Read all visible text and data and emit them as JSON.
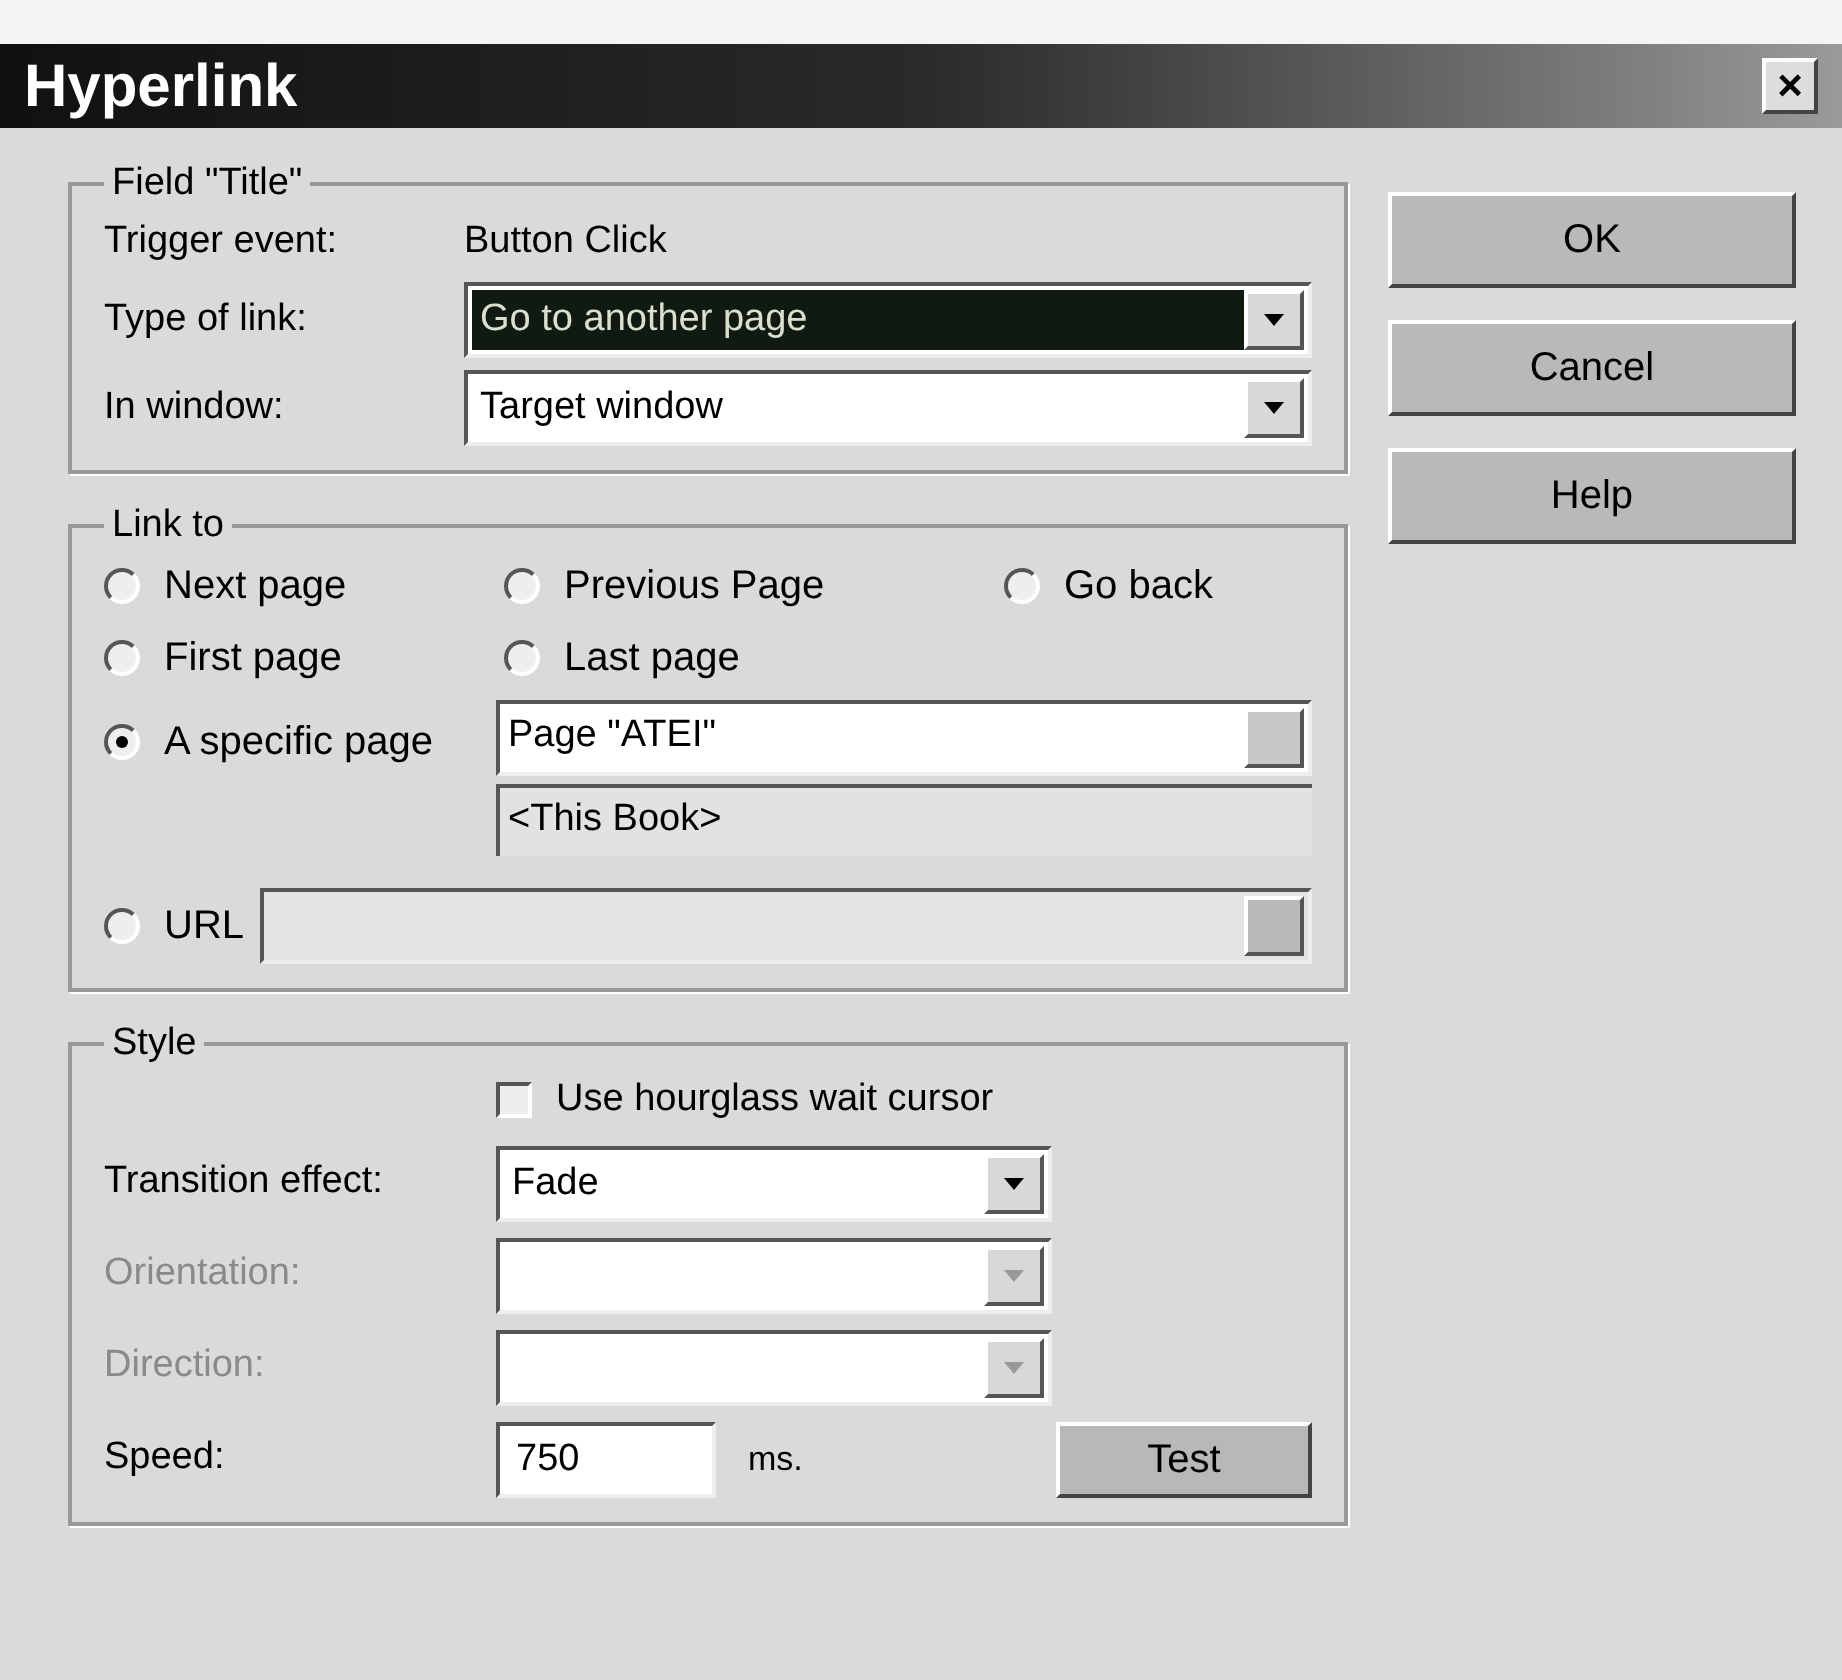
{
  "window": {
    "title": "Hyperlink",
    "close": "×"
  },
  "field_group": {
    "legend": "Field \"Title\"",
    "trigger": {
      "label": "Trigger event:",
      "value": "Button Click"
    },
    "dropdowns": [
      {
        "label": "Type of link:",
        "value": "Go to another page",
        "highlighted": true
      },
      {
        "label": "In window:",
        "value": "Target window",
        "highlighted": false
      }
    ]
  },
  "link_to": {
    "legend": "Link to",
    "radio_rows": [
      [
        {
          "label": "Next page",
          "selected": false
        },
        {
          "label": "Previous Page",
          "selected": false
        },
        {
          "label": "Go back",
          "selected": false
        }
      ],
      [
        {
          "label": "First page",
          "selected": false
        },
        {
          "label": "Last page",
          "selected": false
        }
      ]
    ],
    "specific_page": {
      "label": "A specific page",
      "selected": true,
      "page": "Page \"ATEI\"",
      "book": "<This Book>"
    },
    "url": {
      "label": "URL",
      "selected": false,
      "disabled": true
    }
  },
  "style": {
    "legend": "Style",
    "hourglass": {
      "label": "Use hourglass wait cursor",
      "checked": false
    },
    "dropdowns": [
      {
        "label": "Transition effect:",
        "value": "Fade",
        "disabled": false
      },
      {
        "label": "Orientation:",
        "disabled": true
      },
      {
        "label": "Direction:",
        "disabled": true
      }
    ],
    "speed": {
      "label": "Speed:",
      "value": "750",
      "unit": "ms."
    },
    "test_button": "Test"
  },
  "buttons": [
    "OK",
    "Cancel",
    "Help"
  ]
}
